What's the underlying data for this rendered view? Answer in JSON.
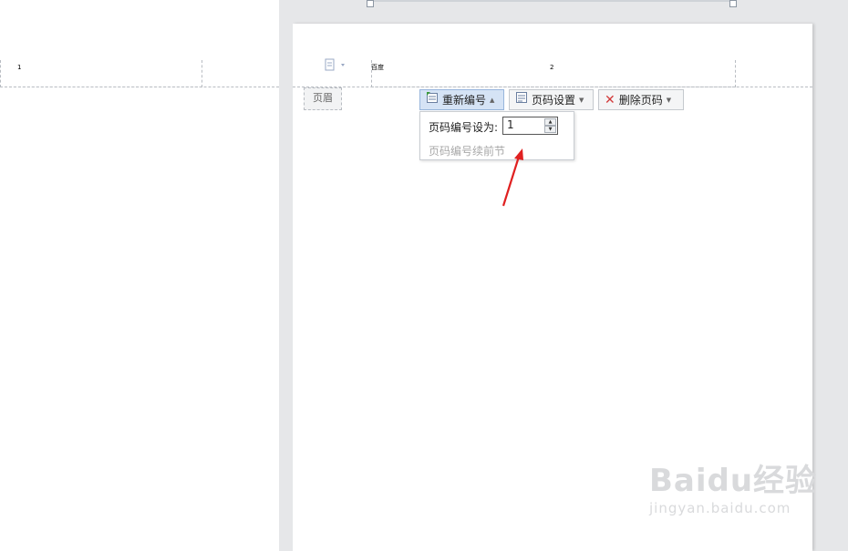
{
  "left_page": {
    "page_number": "1"
  },
  "right_page": {
    "header_text": "百度",
    "page_number": "2",
    "header_tag": "页眉"
  },
  "toolbar": {
    "renumber_label": "重新编号",
    "page_settings_label": "页码设置",
    "delete_label": "删除页码"
  },
  "dropdown": {
    "set_number_label": "页码编号设为:",
    "number_value": "1",
    "continue_label": "页码编号续前节"
  },
  "watermark": {
    "logo_text": "Baidu经验",
    "url_text": "jingyan.baidu.com"
  },
  "colors": {
    "annotation_arrow": "#e02020",
    "active_button": "#d5e3f5"
  }
}
